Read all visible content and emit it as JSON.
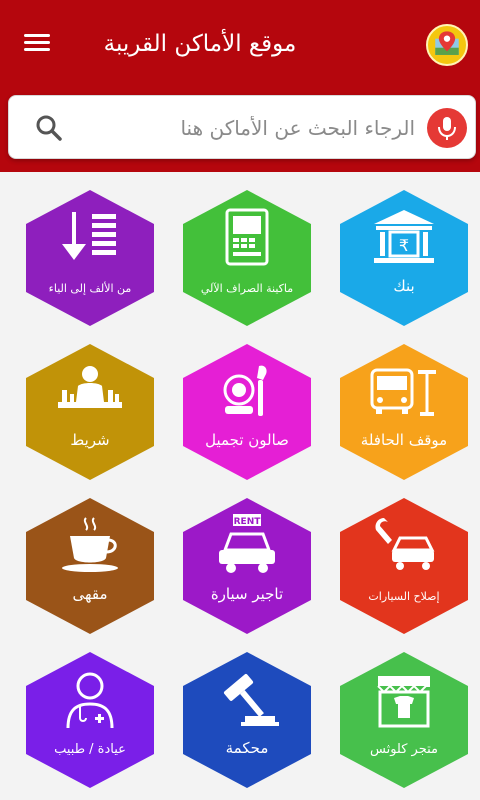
{
  "app": {
    "title": "موقع الأماكن القريبة",
    "primary_color": "#b5060d",
    "menu_icon": "hamburger-menu-icon",
    "logo_icon": "map-pin-logo-icon"
  },
  "search": {
    "placeholder": "الرجاء البحث عن الأماكن هنا",
    "search_icon": "search-icon",
    "mic_icon": "microphone-icon"
  },
  "categories": [
    {
      "id": "bank",
      "label": "بنك",
      "color": "#1aa9e8",
      "icon": "bank-building-icon"
    },
    {
      "id": "atm",
      "label": "ماكينة الصراف الآلي",
      "color": "#43c03a",
      "icon": "atm-machine-icon"
    },
    {
      "id": "az",
      "label": "من الألف إلى الياء",
      "color": "#8e1fbd",
      "icon": "sort-az-icon"
    },
    {
      "id": "bus",
      "label": "موقف الحافلة",
      "color": "#f7a21b",
      "icon": "bus-stop-icon"
    },
    {
      "id": "salon",
      "label": "صالون تجميل",
      "color": "#e51fd5",
      "icon": "makeup-brush-icon"
    },
    {
      "id": "bar",
      "label": "شريط",
      "color": "#c19308",
      "icon": "bartender-icon"
    },
    {
      "id": "repair",
      "label": "إصلاح السيارات",
      "color": "#e2351d",
      "icon": "car-repair-icon"
    },
    {
      "id": "rental",
      "label": "تاجير سيارة",
      "color": "#9c19c8",
      "icon": "car-rent-icon"
    },
    {
      "id": "cafe",
      "label": "مقهى",
      "color": "#9a5418",
      "icon": "coffee-cup-icon"
    },
    {
      "id": "clothes",
      "label": "متجر كلوثس",
      "color": "#47c04c",
      "icon": "clothing-store-icon"
    },
    {
      "id": "court",
      "label": "محكمة",
      "color": "#1e4bbd",
      "icon": "gavel-icon"
    },
    {
      "id": "doctor",
      "label": "عيادة / طبيب",
      "color": "#7a1fe8",
      "icon": "doctor-icon"
    }
  ],
  "rent_sign": "RENT"
}
